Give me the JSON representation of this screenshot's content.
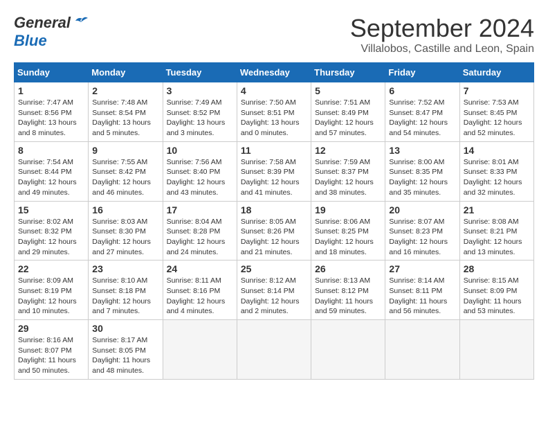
{
  "header": {
    "logo_line1_part1": "General",
    "logo_line2_part1": "Blue",
    "title": "September 2024",
    "subtitle": "Villalobos, Castille and Leon, Spain"
  },
  "days_of_week": [
    "Sunday",
    "Monday",
    "Tuesday",
    "Wednesday",
    "Thursday",
    "Friday",
    "Saturday"
  ],
  "weeks": [
    [
      {
        "day": 1,
        "sunrise": "7:47 AM",
        "sunset": "8:56 PM",
        "daylight": "13 hours and 8 minutes."
      },
      {
        "day": 2,
        "sunrise": "7:48 AM",
        "sunset": "8:54 PM",
        "daylight": "13 hours and 5 minutes."
      },
      {
        "day": 3,
        "sunrise": "7:49 AM",
        "sunset": "8:52 PM",
        "daylight": "13 hours and 3 minutes."
      },
      {
        "day": 4,
        "sunrise": "7:50 AM",
        "sunset": "8:51 PM",
        "daylight": "13 hours and 0 minutes."
      },
      {
        "day": 5,
        "sunrise": "7:51 AM",
        "sunset": "8:49 PM",
        "daylight": "12 hours and 57 minutes."
      },
      {
        "day": 6,
        "sunrise": "7:52 AM",
        "sunset": "8:47 PM",
        "daylight": "12 hours and 54 minutes."
      },
      {
        "day": 7,
        "sunrise": "7:53 AM",
        "sunset": "8:45 PM",
        "daylight": "12 hours and 52 minutes."
      }
    ],
    [
      {
        "day": 8,
        "sunrise": "7:54 AM",
        "sunset": "8:44 PM",
        "daylight": "12 hours and 49 minutes."
      },
      {
        "day": 9,
        "sunrise": "7:55 AM",
        "sunset": "8:42 PM",
        "daylight": "12 hours and 46 minutes."
      },
      {
        "day": 10,
        "sunrise": "7:56 AM",
        "sunset": "8:40 PM",
        "daylight": "12 hours and 43 minutes."
      },
      {
        "day": 11,
        "sunrise": "7:58 AM",
        "sunset": "8:39 PM",
        "daylight": "12 hours and 41 minutes."
      },
      {
        "day": 12,
        "sunrise": "7:59 AM",
        "sunset": "8:37 PM",
        "daylight": "12 hours and 38 minutes."
      },
      {
        "day": 13,
        "sunrise": "8:00 AM",
        "sunset": "8:35 PM",
        "daylight": "12 hours and 35 minutes."
      },
      {
        "day": 14,
        "sunrise": "8:01 AM",
        "sunset": "8:33 PM",
        "daylight": "12 hours and 32 minutes."
      }
    ],
    [
      {
        "day": 15,
        "sunrise": "8:02 AM",
        "sunset": "8:32 PM",
        "daylight": "12 hours and 29 minutes."
      },
      {
        "day": 16,
        "sunrise": "8:03 AM",
        "sunset": "8:30 PM",
        "daylight": "12 hours and 27 minutes."
      },
      {
        "day": 17,
        "sunrise": "8:04 AM",
        "sunset": "8:28 PM",
        "daylight": "12 hours and 24 minutes."
      },
      {
        "day": 18,
        "sunrise": "8:05 AM",
        "sunset": "8:26 PM",
        "daylight": "12 hours and 21 minutes."
      },
      {
        "day": 19,
        "sunrise": "8:06 AM",
        "sunset": "8:25 PM",
        "daylight": "12 hours and 18 minutes."
      },
      {
        "day": 20,
        "sunrise": "8:07 AM",
        "sunset": "8:23 PM",
        "daylight": "12 hours and 16 minutes."
      },
      {
        "day": 21,
        "sunrise": "8:08 AM",
        "sunset": "8:21 PM",
        "daylight": "12 hours and 13 minutes."
      }
    ],
    [
      {
        "day": 22,
        "sunrise": "8:09 AM",
        "sunset": "8:19 PM",
        "daylight": "12 hours and 10 minutes."
      },
      {
        "day": 23,
        "sunrise": "8:10 AM",
        "sunset": "8:18 PM",
        "daylight": "12 hours and 7 minutes."
      },
      {
        "day": 24,
        "sunrise": "8:11 AM",
        "sunset": "8:16 PM",
        "daylight": "12 hours and 4 minutes."
      },
      {
        "day": 25,
        "sunrise": "8:12 AM",
        "sunset": "8:14 PM",
        "daylight": "12 hours and 2 minutes."
      },
      {
        "day": 26,
        "sunrise": "8:13 AM",
        "sunset": "8:12 PM",
        "daylight": "11 hours and 59 minutes."
      },
      {
        "day": 27,
        "sunrise": "8:14 AM",
        "sunset": "8:11 PM",
        "daylight": "11 hours and 56 minutes."
      },
      {
        "day": 28,
        "sunrise": "8:15 AM",
        "sunset": "8:09 PM",
        "daylight": "11 hours and 53 minutes."
      }
    ],
    [
      {
        "day": 29,
        "sunrise": "8:16 AM",
        "sunset": "8:07 PM",
        "daylight": "11 hours and 50 minutes."
      },
      {
        "day": 30,
        "sunrise": "8:17 AM",
        "sunset": "8:05 PM",
        "daylight": "11 hours and 48 minutes."
      },
      null,
      null,
      null,
      null,
      null
    ]
  ]
}
